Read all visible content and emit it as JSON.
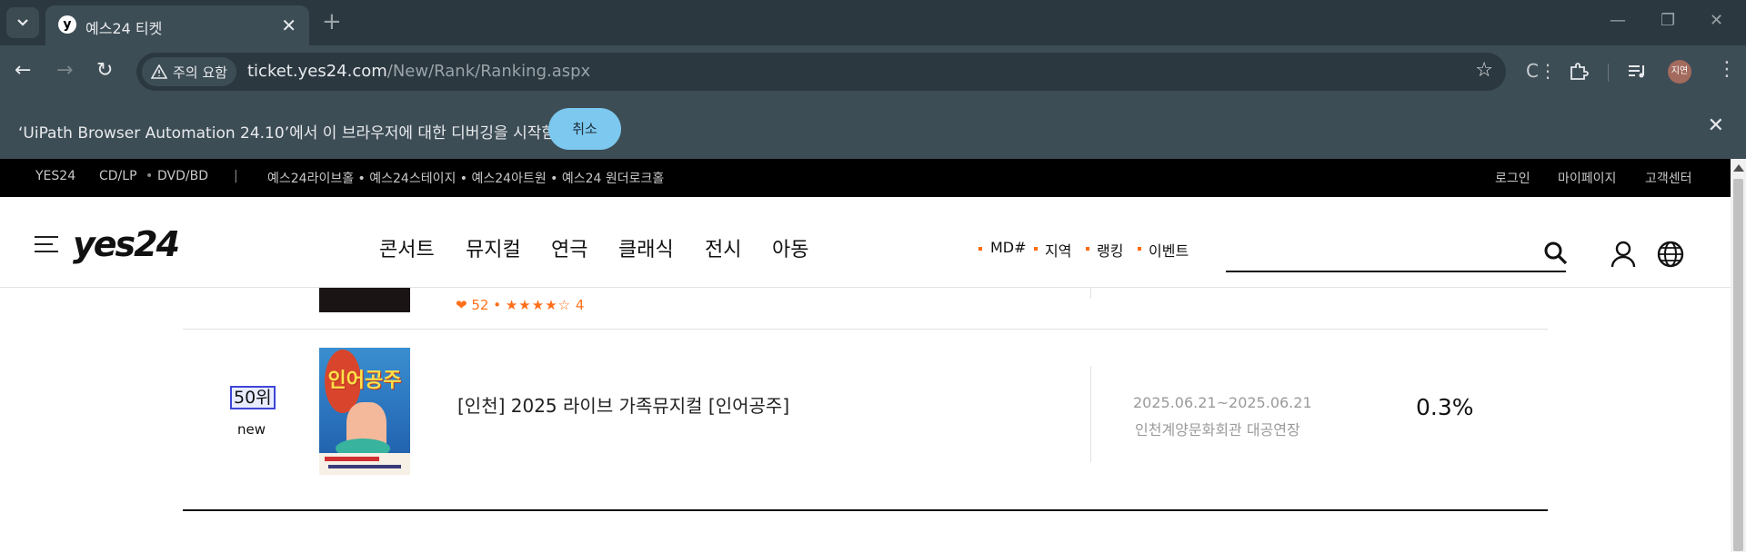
{
  "browser": {
    "tab_title": "예스24 티켓",
    "tab_favicon": "y",
    "new_tab": "+",
    "security_chip": "주의 요함",
    "url_host": "ticket.yes24.com",
    "url_path": "/New/Rank/Ranking.aspx",
    "profile_label": "지연",
    "infobar_message": "‘UiPath Browser Automation 24.10’에서 이 브라우저에 대한 디버깅을 시작함",
    "infobar_cancel": "취소"
  },
  "gnb": {
    "left": [
      "YES24",
      "CD/LP",
      "DVD/BD",
      "|"
    ],
    "venues": "예스24라이브홀 • 예스24스테이지 • 예스24아트원 • 예스24 원더로크홀",
    "right": [
      "로그인",
      "마이페이지",
      "고객센터"
    ]
  },
  "header": {
    "logo": "yes24",
    "main_nav": [
      "콘서트",
      "뮤지컬",
      "연극",
      "클래식",
      "전시",
      "아동"
    ],
    "sub_nav": [
      "MD#",
      "지역",
      "랭킹",
      "이벤트"
    ],
    "search_placeholder": ""
  },
  "prev_item": {
    "likes": "52",
    "stars": "★★★★☆",
    "rating": "4"
  },
  "item": {
    "rank": "50위",
    "badge": "new",
    "poster_title": "인어공주",
    "title": "[인천] 2025 라이브 가족뮤지컬 [인어공주]",
    "date": "2025.06.21~2025.06.21",
    "venue": "인천계양문화회관 대공연장",
    "share": "0.3%"
  },
  "colors": {
    "accent_orange": "#ff6a00",
    "chrome_dark": "#2b3840",
    "chrome_mid": "#3d4d55",
    "infobar_button": "#7cc8ef",
    "rank_highlight": "#3d46d6"
  }
}
